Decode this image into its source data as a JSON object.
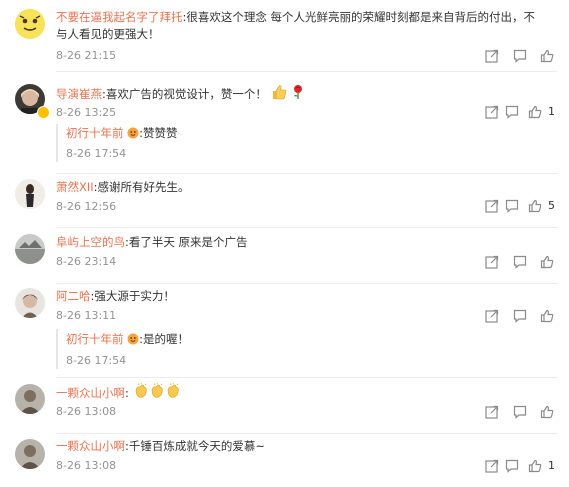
{
  "comments": [
    {
      "user": "不要在逼我起名字了拜托",
      "text": "很喜欢这个理念 每个人光鲜亮丽的荣耀时刻都是来自背后的付出，不与人看见的更强大！",
      "time": "8-26 21:15",
      "likes": ""
    },
    {
      "user": "导演崔燕",
      "text": "喜欢广告的视觉设计，赞一个！",
      "emoji": [
        "thumbs-up-emoji",
        "rose-emoji"
      ],
      "time": "8-26 13:25",
      "likes": "1",
      "reply": {
        "user": "初行十年前",
        "text": "赞赞赞",
        "time": "8-26 17:54"
      }
    },
    {
      "user": "萧然XII",
      "text": "感谢所有好先生。",
      "time": "8-26 12:56",
      "likes": "5"
    },
    {
      "user": "阜屿上空的鸟",
      "text": "看了半天 原来是个广告",
      "time": "8-26 23:14",
      "likes": ""
    },
    {
      "user": "阿二哈",
      "text": "强大源于实力！",
      "time": "8-26 13:11",
      "likes": "",
      "reply": {
        "user": "初行十年前",
        "text": "是的喔！",
        "time": "8-26 17:54"
      }
    },
    {
      "user": "一颗众山小啊",
      "text": "",
      "emoji": [
        "clap-emoji",
        "clap-emoji",
        "clap-emoji"
      ],
      "time": "8-26 13:08",
      "likes": ""
    },
    {
      "user": "一颗众山小啊",
      "text": "千锤百炼成就今天的爱慕~",
      "time": "8-26 13:08",
      "likes": "1"
    }
  ],
  "colors": {
    "username": "#eb7350",
    "time": "#939393",
    "badge": "#ffc000"
  },
  "icons": {
    "share": "share-icon",
    "comment": "comment-icon",
    "like": "thumbs-up-icon"
  }
}
